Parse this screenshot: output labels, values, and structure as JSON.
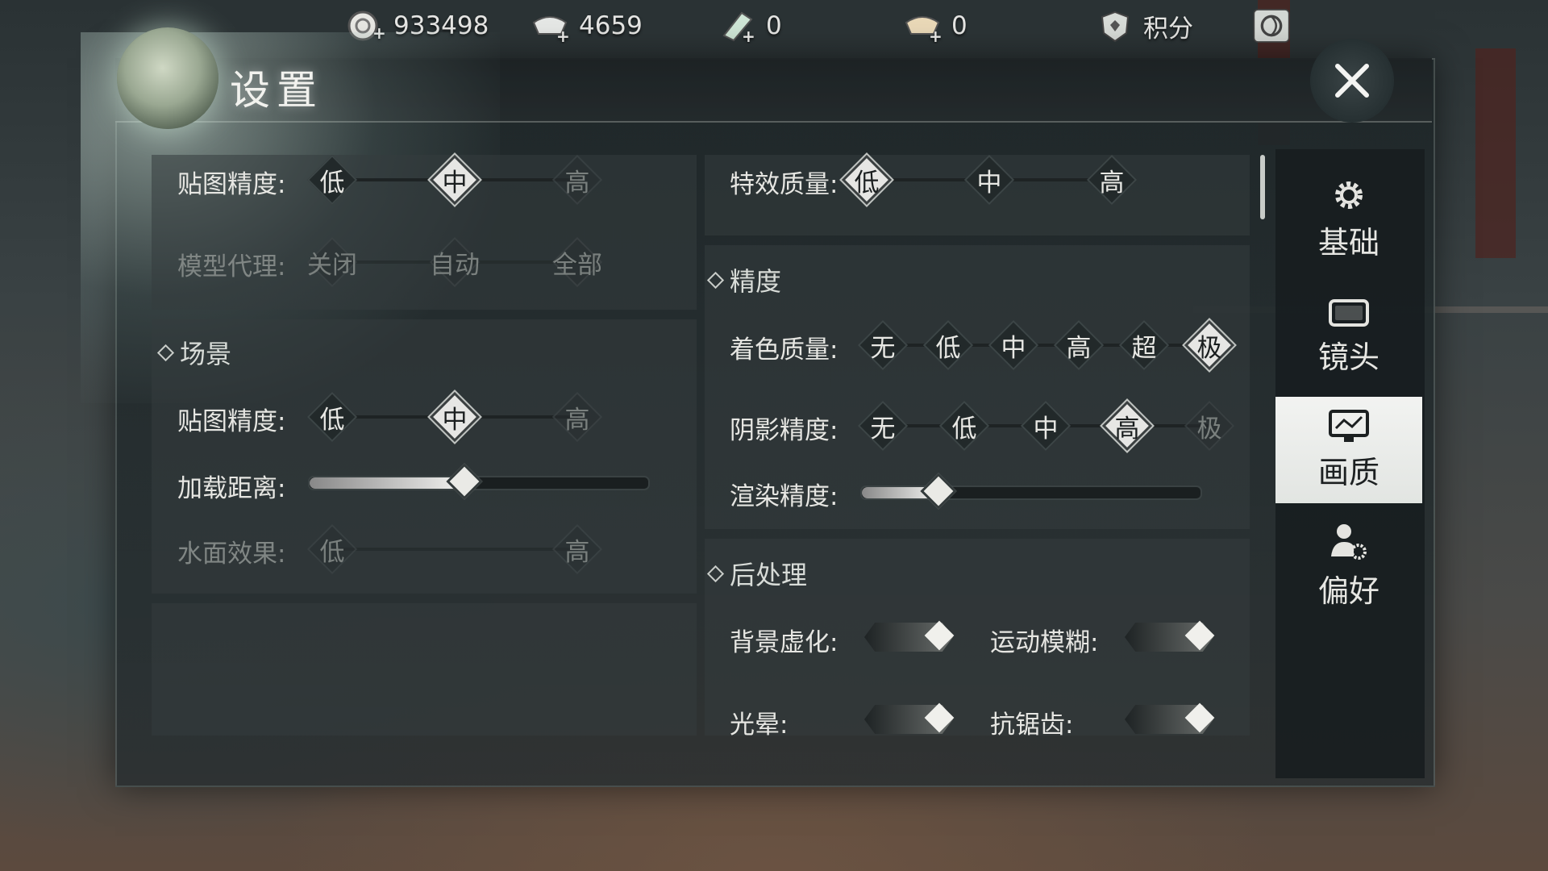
{
  "top_bar": {
    "currencies": [
      {
        "icon": "coin-plus-icon",
        "value": "933498"
      },
      {
        "icon": "silver-ingot-plus-icon",
        "value": "4659"
      },
      {
        "icon": "jade-plus-icon",
        "value": "0"
      },
      {
        "icon": "gold-ingot-plus-icon",
        "value": "0"
      }
    ],
    "points_label": "积分",
    "points_icon": "shield-badge-icon",
    "extra_icon": "swirl-emblem-icon"
  },
  "window": {
    "title": "设置",
    "close_icon": "close-icon"
  },
  "left": {
    "texture_precision_label": "贴图精度:",
    "texture_options": [
      "低",
      "中",
      "高"
    ],
    "texture_selected": "中",
    "model_proxy_label": "模型代理:",
    "model_proxy_options": [
      "关闭",
      "自动",
      "全部"
    ],
    "scene_section": "场景",
    "scene_texture_label": "贴图精度:",
    "scene_texture_options": [
      "低",
      "中",
      "高"
    ],
    "scene_texture_selected": "中",
    "load_distance_label": "加载距离:",
    "load_distance_level": 0.45,
    "water_label": "水面效果:",
    "water_options": [
      "低",
      "高"
    ]
  },
  "right": {
    "effects_label": "特效质量:",
    "effects_options": [
      "低",
      "中",
      "高"
    ],
    "effects_selected": "低",
    "precision_section": "精度",
    "shading_label": "着色质量:",
    "shading_options": [
      "无",
      "低",
      "中",
      "高",
      "超",
      "极"
    ],
    "shading_selected": "极",
    "shadow_label": "阴影精度:",
    "shadow_options": [
      "无",
      "低",
      "中",
      "高",
      "极"
    ],
    "shadow_selected": "高",
    "render_label": "渲染精度:",
    "render_level": 0.22,
    "post_section": "后处理",
    "bg_blur_label": "背景虚化:",
    "motion_blur_label": "运动模糊:",
    "bloom_label": "光晕:",
    "antialias_label": "抗锯齿:"
  },
  "nav": [
    {
      "label": "基础",
      "icon": "gear-icon"
    },
    {
      "label": "镜头",
      "icon": "camera-frame-icon"
    },
    {
      "label": "画质",
      "icon": "monitor-icon",
      "active": true
    },
    {
      "label": "偏好",
      "icon": "user-settings-icon"
    }
  ]
}
